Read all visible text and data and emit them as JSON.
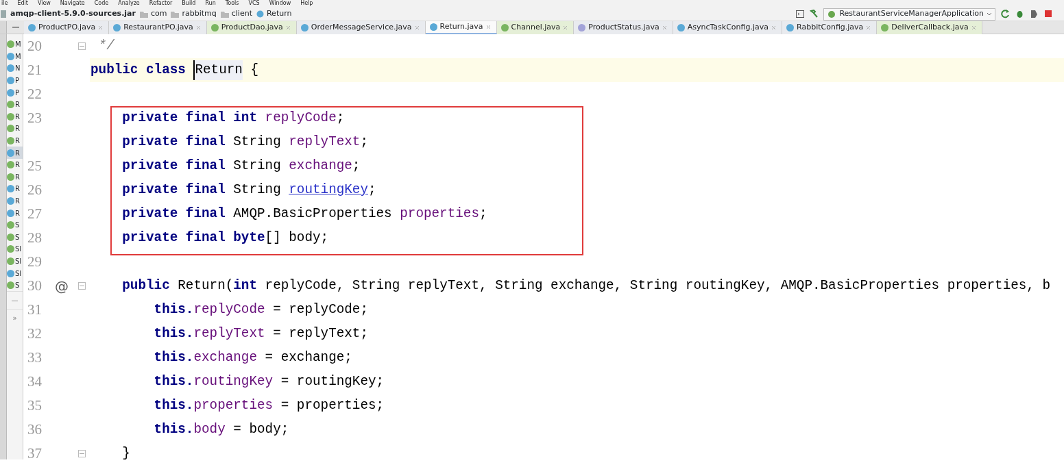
{
  "menu": [
    "ile",
    "Edit",
    "View",
    "Navigate",
    "Code",
    "Analyze",
    "Refactor",
    "Build",
    "Run",
    "Tools",
    "VCS",
    "Window",
    "Help"
  ],
  "breadcrumb": [
    {
      "label": "amqp-client-5.9.0-sources.jar",
      "kind": "jar"
    },
    {
      "label": "com",
      "kind": "package"
    },
    {
      "label": "rabbitmq",
      "kind": "package"
    },
    {
      "label": "client",
      "kind": "package"
    },
    {
      "label": "Return",
      "kind": "class"
    }
  ],
  "run_config": {
    "label": "RestaurantServiceManagerApplication"
  },
  "tabs": [
    {
      "label": "ProductPO.java",
      "kind": "class",
      "selected": false
    },
    {
      "label": "RestaurantPO.java",
      "kind": "class",
      "selected": false
    },
    {
      "label": "ProductDao.java",
      "kind": "interface",
      "selected": false
    },
    {
      "label": "OrderMessageService.java",
      "kind": "class",
      "selected": false
    },
    {
      "label": "Return.java",
      "kind": "class",
      "selected": true
    },
    {
      "label": "Channel.java",
      "kind": "interface",
      "selected": false
    },
    {
      "label": "ProductStatus.java",
      "kind": "enum",
      "selected": false
    },
    {
      "label": "AsyncTaskConfig.java",
      "kind": "class",
      "selected": false
    },
    {
      "label": "RabbitConfig.java",
      "kind": "class",
      "selected": false
    },
    {
      "label": "DeliverCallback.java",
      "kind": "interface",
      "selected": false
    }
  ],
  "project_tree": {
    "items": [
      {
        "label": "M",
        "kind": "interface",
        "selected": false
      },
      {
        "label": "M",
        "kind": "class",
        "selected": false
      },
      {
        "label": "N",
        "kind": "class",
        "selected": false
      },
      {
        "label": "P",
        "kind": "class",
        "selected": false
      },
      {
        "label": "P",
        "kind": "class",
        "selected": false
      },
      {
        "label": "R",
        "kind": "interface",
        "selected": false
      },
      {
        "label": "R",
        "kind": "interface",
        "selected": false
      },
      {
        "label": "R",
        "kind": "interface",
        "selected": false
      },
      {
        "label": "R",
        "kind": "interface",
        "selected": false
      },
      {
        "label": "R",
        "kind": "class",
        "selected": true
      },
      {
        "label": "R",
        "kind": "interface",
        "selected": false
      },
      {
        "label": "R",
        "kind": "interface",
        "selected": false
      },
      {
        "label": "R",
        "kind": "class",
        "selected": false
      },
      {
        "label": "R",
        "kind": "class",
        "selected": false
      },
      {
        "label": "R",
        "kind": "class",
        "selected": false
      },
      {
        "label": "S",
        "kind": "interface",
        "selected": false
      },
      {
        "label": "S",
        "kind": "interface",
        "selected": false
      },
      {
        "label": "Sl",
        "kind": "interface",
        "selected": false
      },
      {
        "label": "Sl",
        "kind": "interface",
        "selected": false
      },
      {
        "label": "Sl",
        "kind": "class",
        "selected": false
      },
      {
        "label": "S",
        "kind": "interface",
        "selected": false
      }
    ],
    "footer": [
      "—",
      "»"
    ]
  },
  "editor": {
    "lines": [
      {
        "number": "20",
        "fold": true,
        "tokens": [
          {
            "text": " */",
            "kind": "comment"
          }
        ]
      },
      {
        "number": "21",
        "current": true,
        "tokens": [
          {
            "text": "public class ",
            "kind": "keyword"
          },
          {
            "text": "Return",
            "kind": "plain",
            "cursor": true
          },
          {
            "text": " {",
            "kind": "plain"
          }
        ]
      },
      {
        "number": "22"
      },
      {
        "number": "23",
        "boxed": true,
        "tokens": [
          {
            "text": "    private final int ",
            "kind": "keyword"
          },
          {
            "text": "replyCode",
            "kind": "field"
          },
          {
            "text": ";",
            "kind": "plain"
          }
        ]
      },
      {
        "boxed": true,
        "tokens": [
          {
            "text": "    private final ",
            "kind": "keyword"
          },
          {
            "text": "String ",
            "kind": "plain"
          },
          {
            "text": "replyText",
            "kind": "field"
          },
          {
            "text": ";",
            "kind": "plain"
          }
        ]
      },
      {
        "number": "25",
        "boxed": true,
        "tokens": [
          {
            "text": "    private final ",
            "kind": "keyword"
          },
          {
            "text": "String ",
            "kind": "plain"
          },
          {
            "text": "exchange",
            "kind": "field"
          },
          {
            "text": ";",
            "kind": "plain"
          }
        ]
      },
      {
        "number": "26",
        "boxed": true,
        "tokens": [
          {
            "text": "    private final ",
            "kind": "keyword"
          },
          {
            "text": "String ",
            "kind": "plain"
          },
          {
            "text": "routingKey",
            "kind": "link"
          },
          {
            "text": ";",
            "kind": "plain"
          }
        ]
      },
      {
        "number": "27",
        "boxed": true,
        "tokens": [
          {
            "text": "    private final ",
            "kind": "keyword"
          },
          {
            "text": "AMQP.BasicProperties ",
            "kind": "plain"
          },
          {
            "text": "properties",
            "kind": "field"
          },
          {
            "text": ";",
            "kind": "plain"
          }
        ]
      },
      {
        "number": "28",
        "boxed": true,
        "tokens": [
          {
            "text": "    private final byte",
            "kind": "keyword"
          },
          {
            "text": "[] body;",
            "kind": "plain"
          }
        ]
      },
      {
        "number": "29"
      },
      {
        "number": "30",
        "marker": "@",
        "fold": true,
        "tokens": [
          {
            "text": "    public ",
            "kind": "keyword"
          },
          {
            "text": "Return(",
            "kind": "plain"
          },
          {
            "text": "int ",
            "kind": "keyword"
          },
          {
            "text": "replyCode, String replyText, String exchange, String routingKey, AMQP.BasicProperties properties, b",
            "kind": "plain"
          }
        ]
      },
      {
        "number": "31",
        "tokens": [
          {
            "text": "        this.",
            "kind": "keyword"
          },
          {
            "text": "replyCode",
            "kind": "field"
          },
          {
            "text": " = replyCode;",
            "kind": "plain"
          }
        ]
      },
      {
        "number": "32",
        "tokens": [
          {
            "text": "        this.",
            "kind": "keyword"
          },
          {
            "text": "replyText",
            "kind": "field"
          },
          {
            "text": " = replyText;",
            "kind": "plain"
          }
        ]
      },
      {
        "number": "33",
        "tokens": [
          {
            "text": "        this.",
            "kind": "keyword"
          },
          {
            "text": "exchange",
            "kind": "field"
          },
          {
            "text": " = exchange;",
            "kind": "plain"
          }
        ]
      },
      {
        "number": "34",
        "tokens": [
          {
            "text": "        this.",
            "kind": "keyword"
          },
          {
            "text": "routingKey",
            "kind": "field"
          },
          {
            "text": " = routingKey;",
            "kind": "plain"
          }
        ]
      },
      {
        "number": "35",
        "tokens": [
          {
            "text": "        this.",
            "kind": "keyword"
          },
          {
            "text": "properties",
            "kind": "field"
          },
          {
            "text": " = properties;",
            "kind": "plain"
          }
        ]
      },
      {
        "number": "36",
        "tokens": [
          {
            "text": "        this.",
            "kind": "keyword"
          },
          {
            "text": "body",
            "kind": "field"
          },
          {
            "text": " = body;",
            "kind": "plain"
          }
        ]
      },
      {
        "number": "37",
        "fold": true,
        "tokens": [
          {
            "text": "    }",
            "kind": "plain"
          }
        ]
      }
    ]
  }
}
